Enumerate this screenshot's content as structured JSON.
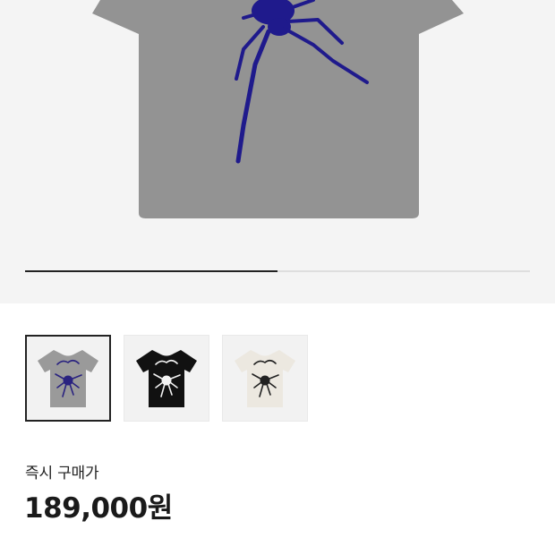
{
  "gallery": {
    "progress_fraction": 0.5,
    "shirt_color": "#939393",
    "graphic_color": "#1f1a8c"
  },
  "thumbnails": [
    {
      "name": "grey",
      "shirt": "#9a9a9a",
      "graphic": "#2a2380",
      "selected": true
    },
    {
      "name": "black",
      "shirt": "#111111",
      "graphic": "#f2f2f2",
      "selected": false
    },
    {
      "name": "cream",
      "shirt": "#ece8e0",
      "graphic": "#222222",
      "selected": false
    }
  ],
  "price": {
    "label": "즉시 구매가",
    "value": "189,000원"
  }
}
